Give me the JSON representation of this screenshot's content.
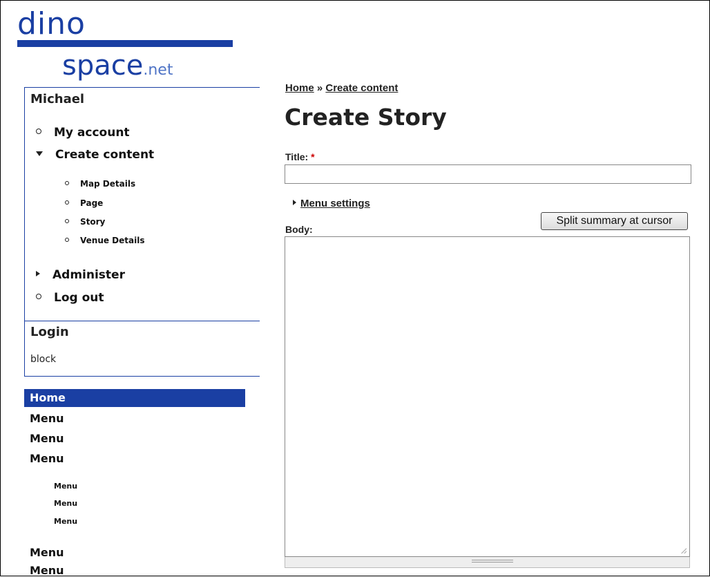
{
  "logo": {
    "dino": "dino",
    "space": "space",
    "net": ".net"
  },
  "user_block": {
    "name": "Michael",
    "nav": {
      "my_account": "My account",
      "create_content": "Create content",
      "sub_items": [
        "Map Details",
        "Page",
        "Story",
        "Venue Details"
      ],
      "administer": "Administer",
      "log_out": "Log out"
    }
  },
  "login_block": {
    "title": "Login",
    "text": "block"
  },
  "primary_menu": {
    "home": "Home",
    "items": [
      "Menu",
      "Menu",
      "Menu"
    ],
    "sub_items": [
      "Menu",
      "Menu",
      "Menu"
    ],
    "items_after": [
      "Menu",
      "Menu"
    ]
  },
  "main": {
    "breadcrumb": {
      "home": "Home",
      "separator": " » ",
      "current": "Create content"
    },
    "title": "Create Story",
    "title_label": "Title:",
    "required_mark": "*",
    "title_value": "",
    "menu_settings": "Menu settings",
    "body_label": "Body:",
    "split_button": "Split summary at cursor",
    "body_value": ""
  },
  "colors": {
    "brand_blue": "#1a3fa3",
    "required_red": "#cc0000"
  }
}
